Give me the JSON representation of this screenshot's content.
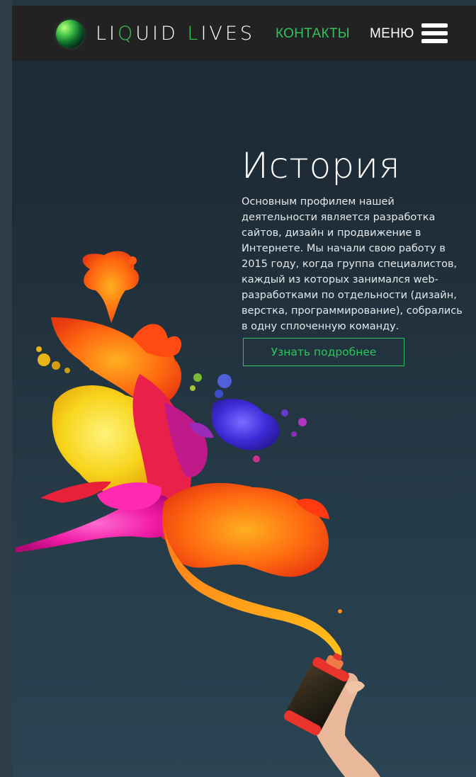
{
  "header": {
    "logo_text_1": "LI",
    "logo_text_q": "Q",
    "logo_text_2": "UID ",
    "logo_text_l": "L",
    "logo_text_3": "IVES",
    "contacts_label": "КОНТАКТЫ",
    "menu_label": "МЕНЮ"
  },
  "hero": {
    "title": "История",
    "text": "Основным профилем нашей деятельности является разработка сайтов, дизайн и продвижение в Интернете. Мы начали свою работу в 2015 году, когда группа специалистов, каждый из которых занимался web-разработками по отдельности (дизайн, верстка, программирование), собрались в одну сплоченную команду.",
    "button_label": "Узнать подробнее"
  },
  "colors": {
    "accent": "#2ec45c",
    "header_bg": "#222222",
    "page_bg": "#253842"
  },
  "icons": [
    "logo-globe-icon",
    "hamburger-menu-icon"
  ],
  "illustration": "paint-splash-spray-can"
}
